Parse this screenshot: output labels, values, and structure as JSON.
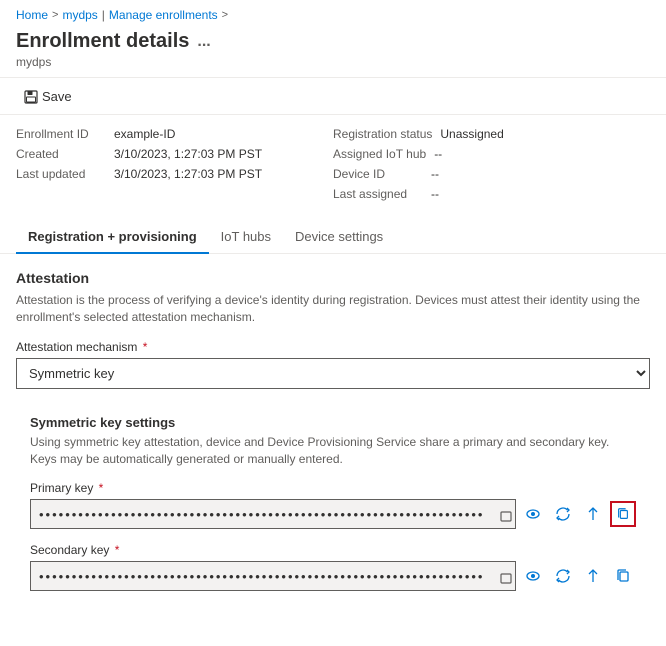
{
  "breadcrumb": {
    "home": "Home",
    "separator1": ">",
    "mydps": "mydps",
    "pipe": "|",
    "manage": "Manage enrollments",
    "separator2": ">"
  },
  "header": {
    "title": "Enrollment details",
    "dots": "...",
    "subtitle": "mydps"
  },
  "toolbar": {
    "save_label": "Save"
  },
  "details": {
    "left": [
      {
        "label": "Enrollment ID",
        "value": "example-ID",
        "blue": false
      },
      {
        "label": "Created",
        "value": "3/10/2023, 1:27:03 PM PST",
        "blue": false
      },
      {
        "label": "Last updated",
        "value": "3/10/2023, 1:27:03 PM PST",
        "blue": false
      }
    ],
    "right": [
      {
        "label": "Registration status",
        "value": "Unassigned",
        "blue": false
      },
      {
        "label": "Assigned IoT hub",
        "value": "--",
        "blue": false
      },
      {
        "label": "Device ID",
        "value": "--",
        "blue": false
      },
      {
        "label": "Last assigned",
        "value": "--",
        "blue": false
      }
    ]
  },
  "tabs": [
    {
      "id": "registration",
      "label": "Registration + provisioning",
      "active": true
    },
    {
      "id": "iothubs",
      "label": "IoT hubs",
      "active": false
    },
    {
      "id": "devicesettings",
      "label": "Device settings",
      "active": false
    }
  ],
  "attestation": {
    "section_title": "Attestation",
    "section_desc": "Attestation is the process of verifying a device's identity during registration. Devices must attest their identity using the enrollment's selected attestation mechanism.",
    "mechanism_label": "Attestation mechanism",
    "mechanism_required": "*",
    "mechanism_value": "Symmetric key",
    "symkey_title": "Symmetric key settings",
    "symkey_desc": "Using symmetric key attestation, device and Device Provisioning Service share a primary and secondary key. Keys may be automatically generated or manually entered.",
    "primary_key_label": "Primary key",
    "primary_key_required": "*",
    "primary_key_placeholder": "••••••••••••••••••••••••••••••••••••••••••••••••••••••••••••••••••••••••••••••••••••••",
    "secondary_key_label": "Secondary key",
    "secondary_key_required": "*",
    "secondary_key_placeholder": "••••••••••••••••••••••••••••••••••••••••••••••••••••••••••••••••••••••••••••••••••••••"
  }
}
